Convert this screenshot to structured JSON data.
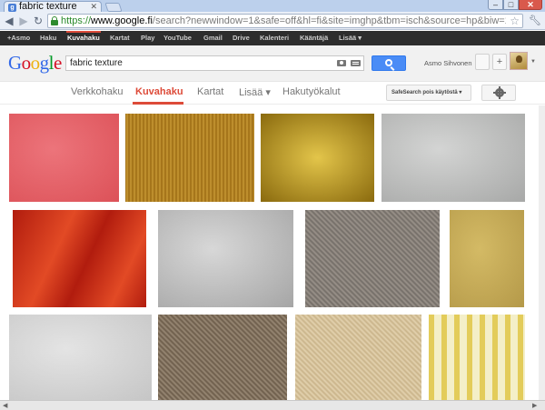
{
  "browser": {
    "tab_title": "fabric texture",
    "url_scheme": "https://",
    "url_host": "www.google.fi",
    "url_path": "/search?newwindow=1&safe=off&hl=fi&site=imghp&tbm=isch&source=hp&biw=1047&",
    "back_icon": "back-arrow-icon",
    "forward_icon": "forward-arrow-icon",
    "reload_icon": "reload-icon",
    "star_icon": "bookmark-star-icon",
    "wrench_icon": "wrench-icon"
  },
  "gbar": {
    "items": [
      "+Asmo",
      "Haku",
      "Kuvahaku",
      "Kartat",
      "Play",
      "YouTube",
      "Gmail",
      "Drive",
      "Kalenteri",
      "Kääntäjä",
      "Lisää ▾"
    ],
    "active": "Kuvahaku",
    "accent_color": "#dd4b39"
  },
  "header": {
    "logo_letters": [
      "G",
      "o",
      "o",
      "g",
      "l",
      "e"
    ],
    "logo_colors": [
      "#3369e8",
      "#d50f25",
      "#eeb211",
      "#3369e8",
      "#009925",
      "#d50f25"
    ],
    "query": "fabric texture",
    "user_name": "Asmo Sihvonen",
    "share_label": "+"
  },
  "tabs": {
    "items": [
      "Verkkohaku",
      "Kuvahaku",
      "Kartat",
      "Lisää ▾",
      "Hakutyökalut"
    ],
    "active": "Kuvahaku",
    "safesearch_label": "SafeSearch pois käytöstä ▾"
  },
  "results": {
    "images": [
      {
        "desc": "red-fabric",
        "colors": [
          "#e14e55",
          "#f2737a"
        ]
      },
      {
        "desc": "gold-striped-fabric",
        "colors": [
          "#9a6a12",
          "#c99a36"
        ]
      },
      {
        "desc": "golden-yellow-fabric",
        "colors": [
          "#8a6a0e",
          "#e3c54a"
        ]
      },
      {
        "desc": "grey-fabric",
        "colors": [
          "#a9aaa9",
          "#d8d9d8"
        ]
      },
      {
        "desc": "red-silk-fabric",
        "colors": [
          "#b11c0e",
          "#e24a25"
        ]
      },
      {
        "desc": "white-crinkle-fabric",
        "colors": [
          "#a7a7a7",
          "#dcdcdc"
        ]
      },
      {
        "desc": "grey-linen-fabric",
        "colors": [
          "#716b65",
          "#9c948c"
        ]
      },
      {
        "desc": "ochre-fabric",
        "colors": [
          "#b79a45",
          "#d8bd63"
        ]
      },
      {
        "desc": "light-grey-fabric",
        "colors": [
          "#c9c9c9",
          "#e9e9e9"
        ]
      },
      {
        "desc": "brown-tweed-fabric",
        "colors": [
          "#6a5a48",
          "#9a8a76"
        ]
      },
      {
        "desc": "beige-canvas-fabric",
        "colors": [
          "#c8b288",
          "#e4d3b0"
        ]
      },
      {
        "desc": "yellow-stripe-fabric",
        "colors": [
          "#e3cc5a",
          "#f4efc8"
        ]
      }
    ]
  }
}
